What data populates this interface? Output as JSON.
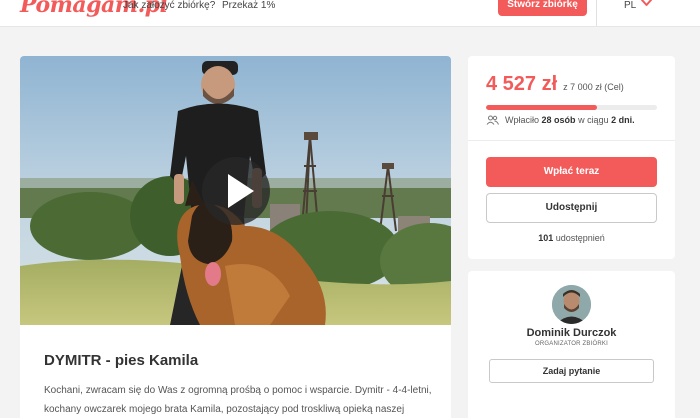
{
  "nav": {
    "logo": "Pomagam.pl",
    "how_to_link": "Jak założyć zbiórkę?",
    "donate_1_link": "Przekaż 1%",
    "create_button": "Stwórz zbiórkę",
    "language": "PL",
    "language_icon": "chevron-down-icon"
  },
  "campaign": {
    "title": "DYMITR - pies Kamila",
    "description": "Kochani, zwracam się do Was z ogromną prośbą o pomoc i wsparcie. Dymitr - 4-4-letni, kochany owczarek mojego brata Kamila, pozostający pod troskliwą opieką naszej",
    "video_icon": "play-icon"
  },
  "donation": {
    "raised": "4 527 zł",
    "goal_text": "z 7 000 zł (Cel)",
    "progress_fraction": 0.647,
    "supporters_prefix": "Wpłaciło",
    "supporters_count": "28 osób",
    "supporters_mid": "w ciągu",
    "supporters_period": "2 dni.",
    "pay_button": "Wpłać teraz",
    "share_button": "Udostępnij",
    "shares_count": "101",
    "shares_label": "udostępnień",
    "supporters_icon": "people-icon"
  },
  "organizer": {
    "name": "Dominik Durczok",
    "role": "ORGANIZATOR ZBIÓRKI",
    "ask_button": "Zadaj pytanie"
  },
  "colors": {
    "accent": "#f35b5b",
    "background": "#f3f3f3"
  }
}
